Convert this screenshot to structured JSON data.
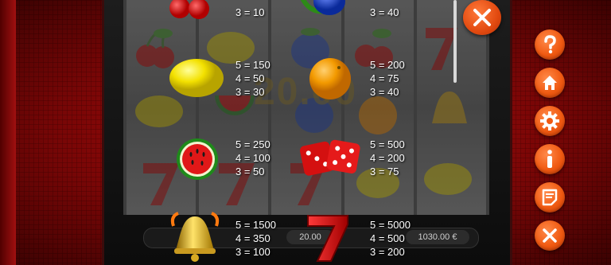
{
  "game": {
    "win_amount": "20.00",
    "bet_display": "20.00",
    "balance_display": "1030.00 €"
  },
  "paytable": [
    {
      "symbol": "cherries-icon",
      "lines": [
        "3 = 10"
      ]
    },
    {
      "symbol": "plum-icon",
      "lines": [
        "3 = 40"
      ]
    },
    {
      "symbol": "lemon-icon",
      "lines": [
        "5 = 150",
        "4 = 50",
        "3 = 30"
      ]
    },
    {
      "symbol": "orange-icon",
      "lines": [
        "5 = 200",
        "4 = 75",
        "3 = 40"
      ]
    },
    {
      "symbol": "watermelon-icon",
      "lines": [
        "5 = 250",
        "4 = 100",
        "3 = 50"
      ]
    },
    {
      "symbol": "dice-icon",
      "lines": [
        "5 = 500",
        "4 = 200",
        "3 = 75"
      ]
    },
    {
      "symbol": "bell-icon",
      "lines": [
        "5 = 1500",
        "4 = 350",
        "3 = 100"
      ]
    },
    {
      "symbol": "seven-icon",
      "lines": [
        "5 = 5000",
        "4 = 500",
        "3 = 200"
      ]
    }
  ],
  "menu": {
    "close": "close-icon",
    "items": [
      "help-icon",
      "home-icon",
      "settings-icon",
      "info-icon",
      "notes-icon",
      "exit-icon"
    ]
  },
  "colors": {
    "accent": "#f05a12",
    "background": "#9a0c0c",
    "text": "#ffffff"
  }
}
